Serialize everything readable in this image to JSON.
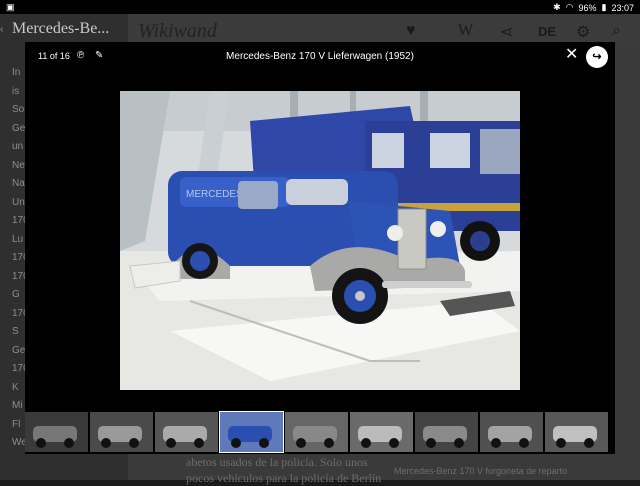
{
  "status": {
    "time": "23:07",
    "battery": "96%"
  },
  "background": {
    "article_title": "Mercedes-Be...",
    "app_name": "Wikiwand",
    "language": "DE",
    "left_snippets": [
      "In",
      "is",
      "So",
      "Ge",
      "un",
      "Ne",
      "Na",
      "Un",
      "170",
      "Lu",
      "170",
      "170",
      "G",
      "170",
      "S",
      "Ge",
      "170",
      "K",
      "Mi",
      "Fl",
      "We"
    ],
    "body_text": "abetos usados de la policía. Solo unos pocos vehículos para la policía de Berlín",
    "caption": "Mercedes-Benz 170 V furgoneta de reparto"
  },
  "lightbox": {
    "counter": "11 of 16",
    "title": "Mercedes-Benz 170 V Lieferwagen (1952)",
    "thumbnails_count": 9,
    "selected_thumbnail_index": 3
  }
}
